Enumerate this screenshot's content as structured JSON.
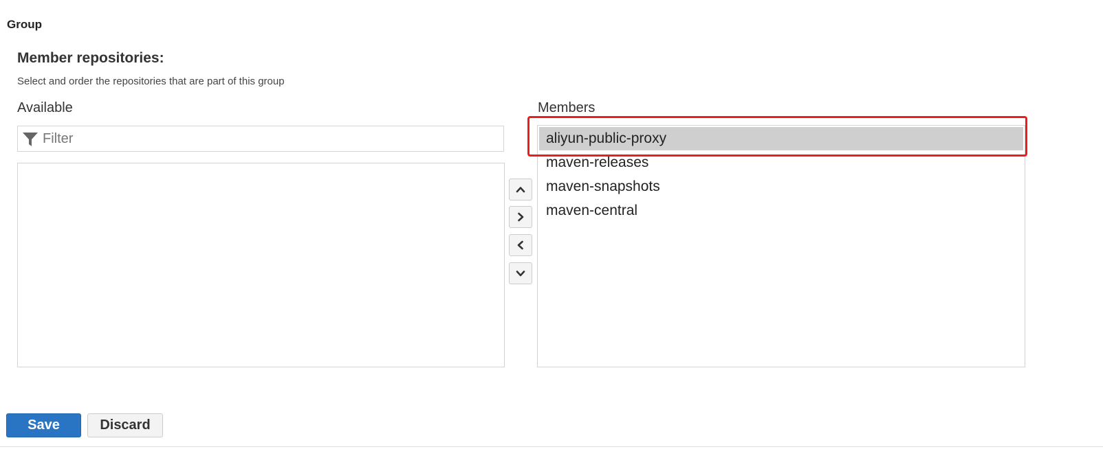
{
  "section": {
    "title": "Group"
  },
  "members_field": {
    "title": "Member repositories:",
    "help": "Select and order the repositories that are part of this group",
    "available_label": "Available",
    "members_label": "Members",
    "filter": {
      "placeholder": "Filter",
      "value": "",
      "icon": "filter-icon"
    },
    "available_items": [],
    "member_items": [
      {
        "label": "aliyun-public-proxy",
        "selected": true
      },
      {
        "label": "maven-releases",
        "selected": false
      },
      {
        "label": "maven-snapshots",
        "selected": false
      },
      {
        "label": "maven-central",
        "selected": false
      }
    ],
    "order_buttons": [
      {
        "name": "move-up-button",
        "icon": "chevron-up-icon"
      },
      {
        "name": "add-to-members-button",
        "icon": "chevron-right-icon"
      },
      {
        "name": "remove-from-members-button",
        "icon": "chevron-left-icon"
      },
      {
        "name": "move-down-button",
        "icon": "chevron-down-icon"
      }
    ]
  },
  "actions": {
    "save_label": "Save",
    "discard_label": "Discard"
  },
  "annotation": {
    "highlight_color": "#ee1c1c",
    "highlighted_item": "aliyun-public-proxy"
  },
  "colors": {
    "primary": "#2a74c4",
    "selected_row": "#cfcfcf"
  }
}
